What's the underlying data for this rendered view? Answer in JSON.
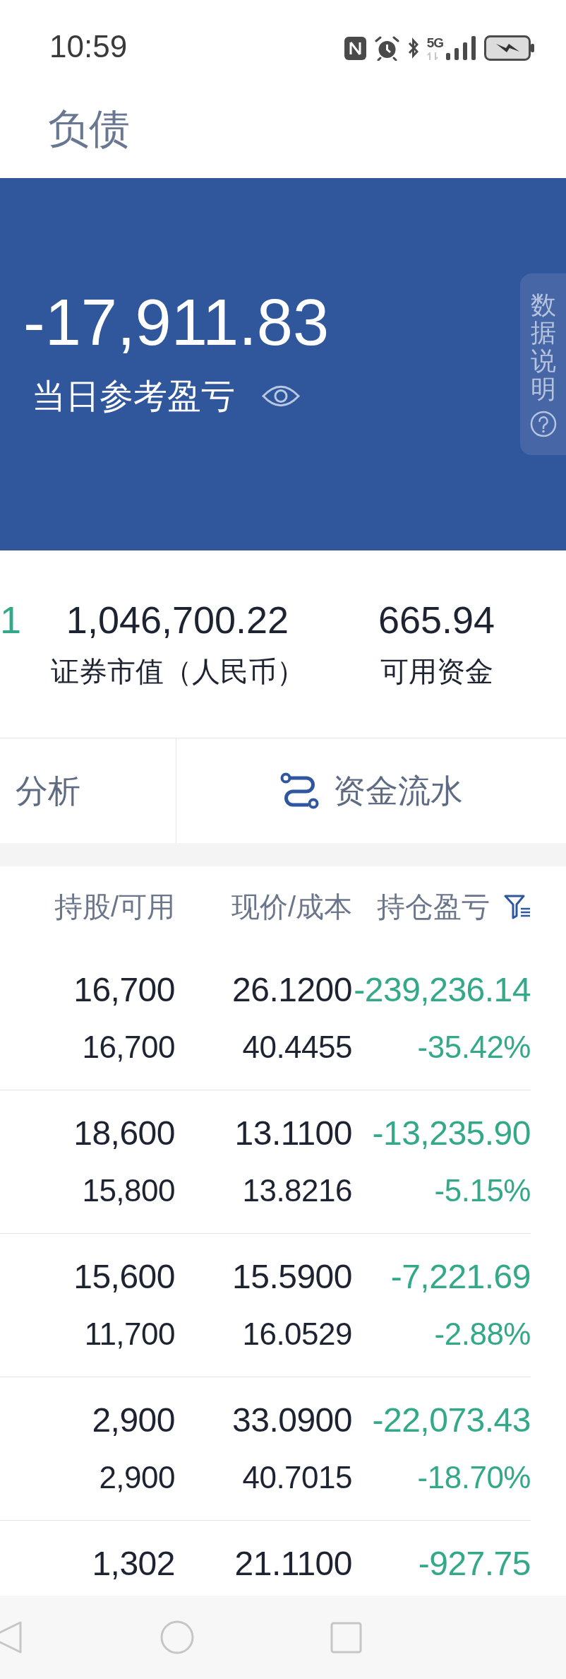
{
  "status_bar": {
    "time": "10:59",
    "network": "5G"
  },
  "header": {
    "tabs": [
      {
        "label": "负债",
        "selected": false
      }
    ]
  },
  "summary": {
    "value": "-17,911.83",
    "label": "当日参考盈亏"
  },
  "side_tab": {
    "label": "数据说明"
  },
  "stats": [
    {
      "kind": "change",
      "value": "1"
    },
    {
      "kind": "amount",
      "value": "1,046,700.22",
      "label": "证券市值（人民币）"
    },
    {
      "kind": "amount",
      "value": "665.94",
      "label": "可用资金"
    }
  ],
  "actions": [
    {
      "label": "分析",
      "icon": false
    },
    {
      "label": "资金流水",
      "icon": true
    }
  ],
  "table": {
    "columns": [
      "持股/可用",
      "现价/成本",
      "持仓盈亏"
    ],
    "rows": [
      {
        "shares": "16,700",
        "available": "16,700",
        "price": "26.1200",
        "cost": "40.4455",
        "pnl": "-239,236.14",
        "pnl_pct": "-35.42%"
      },
      {
        "shares": "18,600",
        "available": "15,800",
        "price": "13.1100",
        "cost": "13.8216",
        "pnl": "-13,235.90",
        "pnl_pct": "-5.15%"
      },
      {
        "shares": "15,600",
        "available": "11,700",
        "price": "15.5900",
        "cost": "16.0529",
        "pnl": "-7,221.69",
        "pnl_pct": "-2.88%"
      },
      {
        "shares": "2,900",
        "available": "2,900",
        "price": "33.0900",
        "cost": "40.7015",
        "pnl": "-22,073.43",
        "pnl_pct": "-18.70%"
      },
      {
        "shares": "1,302",
        "price": "21.1100",
        "pnl": "-927.75"
      }
    ]
  }
}
